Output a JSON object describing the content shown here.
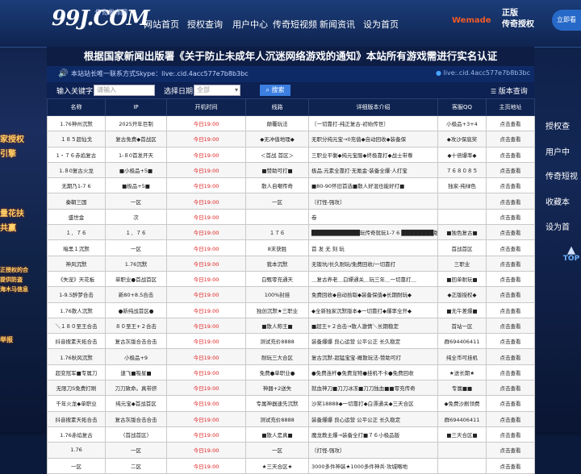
{
  "header": {
    "logo": "99J.COM",
    "logo_sub": "传奇发布网",
    "nav": [
      "网站首页",
      "授权查询",
      "用户中心",
      "传奇短视频",
      "新闻资讯",
      "设为首页"
    ],
    "wemade": "Wemade",
    "auth_badge": [
      "正版",
      "传奇授权"
    ],
    "side_button": "立即看"
  },
  "notice": "根据国家新闻出版署《关于防止未成年人沉迷网络游戏的通知》本站所有游戏需进行实名认证",
  "marquee": "本站站长唯一联系方式Skype：live:.cid.4acc577e7b8b3bc",
  "skype_right": "live:.cid.4acc577e7b8b3bc",
  "search": {
    "keyword_label": "输入关键字",
    "keyword_placeholder": "请输入",
    "date_label": "选择日期",
    "date_value": "全部",
    "button": "搜索",
    "sort": "版本查询"
  },
  "table": {
    "headers": [
      "名称",
      "IP",
      "开机时间",
      "线路",
      "详细版本介绍",
      "客服QQ",
      "主页地址"
    ],
    "rows": [
      [
        "1.76神州沉默",
        "2025开年巨制",
        "今日19:00",
        "颠覆玩法",
        "〔一切靠打-纯正复古-初始传世〕",
        "小极品+3+4",
        "点击查看"
      ],
      [
        "１８５超仙戈",
        "复古免费◆首战区",
        "今日19:00",
        "◆无冲值地理◆",
        "无职分纯元宝→0充值◆自动回收◆装备保",
        "◆攻沙保底奖",
        "点击查看"
      ],
      [
        "1・７６赤焰复古",
        "1-８0首发开天",
        "今日19:00",
        "＜首战 首区＞",
        "三职业平衡◆纯元宝服◆终极靠打◆战士带尊",
        "◆十倍爆率◆",
        "点击查看"
      ],
      [
        "1.８0复古火龙",
        "■小极品+5■",
        "今日19:00",
        "■赞助可打■",
        "极品.元素全靠打·无氪金·装备全爆·人打宝",
        "７６８０８５",
        "点击查看"
      ],
      [
        "无期乃1-7 6",
        "■极品+5■",
        "今日19:00",
        "散人自嘲传奇",
        "■80-90怀旧首选■散人好混也能好打■",
        "独家-纯绿色",
        "点击查看"
      ],
      [
        "秦朝三国",
        "一区",
        "今日19:00",
        "一区",
        "〔打怪-强攻〕",
        "",
        "点击查看"
      ],
      [
        "盛世金",
        "次",
        "今日19:00",
        "",
        "卷",
        "",
        "点击查看"
      ],
      [
        "１．７６",
        "１．７６",
        "今日19:00",
        "１７６",
        "████████████玩传奇就玩1-7 6 ████████版",
        "■独色复古■",
        "点击查看"
      ],
      [
        "暗黑１沉默",
        "一区",
        "今日19:00",
        "8末获胜",
        "首 发 无 刻 玩",
        "首战首区",
        "点击查看"
      ],
      [
        "神风沉默",
        "1.76沉默",
        "今日19:00",
        "我本沉默",
        "无锻坑/长久耐玩/免费回收/一切靠打",
        "三职业",
        "点击查看"
      ],
      [
        "《失宠》天花板",
        "单职业●首战首区",
        "今日19:00",
        "白甄零充通天",
        "＿复古养老＿白嫖通关＿玩三年＿一切靠打＿",
        "■回单耐玩■",
        "点击查看"
      ],
      [
        "1-9.5醉梦合击",
        "新80+8.5合击",
        "今日19:00",
        "100%封挂",
        "免费回收◆自动拾取◆装备保值◆长期耐玩◆",
        "◆正版授权◆",
        "点击查看"
      ],
      [
        "1.76散人沉默",
        "●新纯战首区●",
        "今日19:00",
        "独创沉默★三职业",
        "◆全新独家沉默版本◆一切靠打◆爆率全开◆",
        "■无午差爆■",
        "点击查看"
      ],
      [
        "＼１８０至王合击",
        "８０至王+２合击",
        "今日19:00",
        "■散人称王■",
        "■超王+２合击→散人激情＼长期稳定",
        "首站一区",
        "点击查看"
      ],
      [
        "抖音搜素天拓合击",
        "复古灰版合击合击",
        "今日19:00",
        "测试充价8888",
        "装备爆爆 良心运营 公平公正 长久稳定",
        "群694406411",
        "点击查看"
      ],
      [
        "1.76秋风沉默",
        "小极品+9",
        "今日19:00",
        "耐玩三大合区",
        "复古沉默-超猛宝宝-概散玩法-赞助可打",
        "纯全币可挂机",
        "点击查看"
      ],
      [
        "超变冠军■专属刀",
        "速飞■吸星■",
        "今日19:00",
        "免费●单职业●",
        "●免费连杆●免费宠物●挂机不卡●免费回收",
        "★送长期★",
        "点击查看"
      ],
      [
        "无限刀S免费打刷",
        "刀刀致命。真带挤",
        "今日19:00",
        "神器+2送失",
        "就血神刀■刀刀冰冻■刀刀独血■■零充传奇",
        "专属■■",
        "点击查看"
      ],
      [
        "千年火龙◆单职业",
        "纯元宝◆首战首区",
        "今日19:00",
        "专属神器速先沉默",
        "沙奖18888◆一切靠打◆白漂通关◆三天合区",
        "◆免费沙剧领费",
        "点击查看"
      ],
      [
        "抖音搜素天拓合击",
        "复古灰版合击合击",
        "今日19:00",
        "测试充价8888",
        "装备爆爆 良心运营 公平公正 长久稳定",
        "群694406411",
        "点击查看"
      ],
      [
        "1.76赤焰复古",
        "〈首战首区〉",
        "今日19:00",
        "■散人是真■",
        "魔龙教主爆→装备全打■７６小极品版",
        "■三天合区■",
        "点击查看"
      ],
      [
        "1.76",
        "一区",
        "今日19:00",
        "一区",
        "〔打怪-强攻〕",
        "",
        "点击查看"
      ],
      [
        "一区",
        "二区",
        "今日19:00",
        "★三天合区★",
        "3000多件神装★1000多件神兵·攻城略地",
        "",
        "点击查看"
      ]
    ]
  },
  "right_menu": [
    "授权查",
    "用户中",
    "传奇短视",
    "收藏本",
    "设为首"
  ],
  "top_label": "TOP",
  "promo_left": [
    "家授权",
    "引擎",
    "量花扶",
    "共赢",
    "正授权的合",
    "提供防盗",
    "海木马信息",
    "举报"
  ],
  "colors": {
    "nav_bg": "#1b3d7a",
    "notice_bg": "#0d1d44",
    "table_header": "#0e2350",
    "time_red": "#e02020",
    "link_blue": "#1c5fd6",
    "accent": "#3c7fe0"
  }
}
